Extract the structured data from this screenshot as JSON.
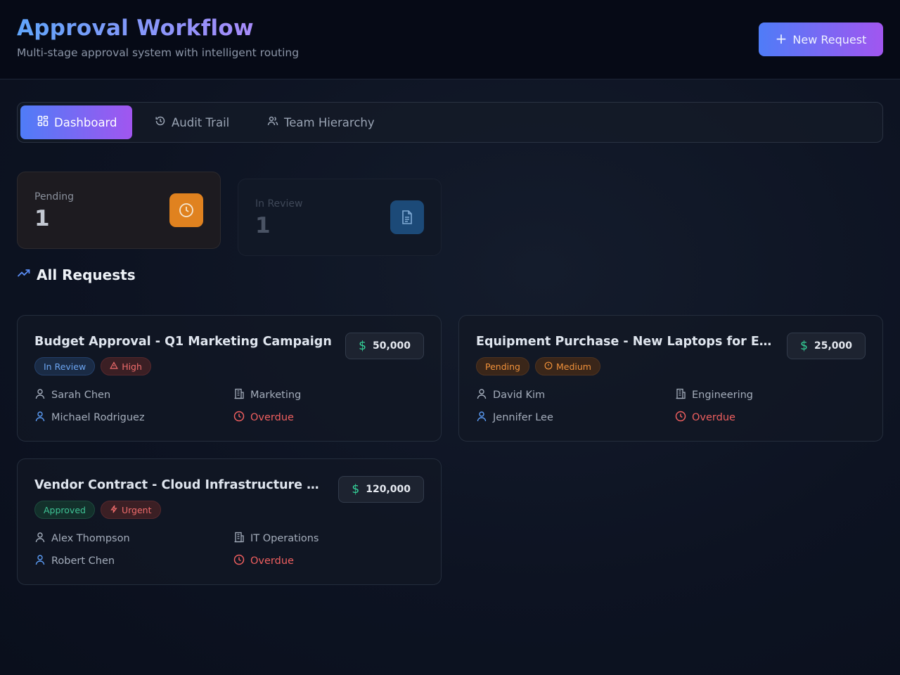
{
  "header": {
    "title": "Approval Workflow",
    "subtitle": "Multi-stage approval system with intelligent routing",
    "new_request_label": "New Request"
  },
  "tabs": [
    {
      "label": "Dashboard",
      "icon": "dashboard-icon",
      "active": true
    },
    {
      "label": "Audit Trail",
      "icon": "history-icon",
      "active": false
    },
    {
      "label": "Team Hierarchy",
      "icon": "users-icon",
      "active": false
    }
  ],
  "stats": [
    {
      "label": "Pending",
      "value": "1",
      "icon": "clock-icon",
      "color": "#e0821f"
    },
    {
      "label": "In Review",
      "value": "1",
      "icon": "document-icon",
      "color": "#2f80d0"
    }
  ],
  "section": {
    "title": "All Requests",
    "icon": "trending-up-icon"
  },
  "requests": [
    {
      "title": "Budget Approval - Q1 Marketing Campaign",
      "amount": "50,000",
      "status": "In Review",
      "priority": "High",
      "requester": "Sarah Chen",
      "department": "Marketing",
      "approver": "Michael Rodriguez",
      "due": "Overdue"
    },
    {
      "title": "Equipment Purchase - New Laptops for Engineering",
      "amount": "25,000",
      "status": "Pending",
      "priority": "Medium",
      "requester": "David Kim",
      "department": "Engineering",
      "approver": "Jennifer Lee",
      "due": "Overdue"
    },
    {
      "title": "Vendor Contract - Cloud Infrastructure Renewal",
      "amount": "120,000",
      "status": "Approved",
      "priority": "Urgent",
      "requester": "Alex Thompson",
      "department": "IT Operations",
      "approver": "Robert Chen",
      "due": "Overdue"
    }
  ],
  "colors": {
    "accent_start": "#4f7cf7",
    "accent_end": "#a156f0",
    "overdue": "#ef5f5f",
    "money": "#34d399"
  }
}
